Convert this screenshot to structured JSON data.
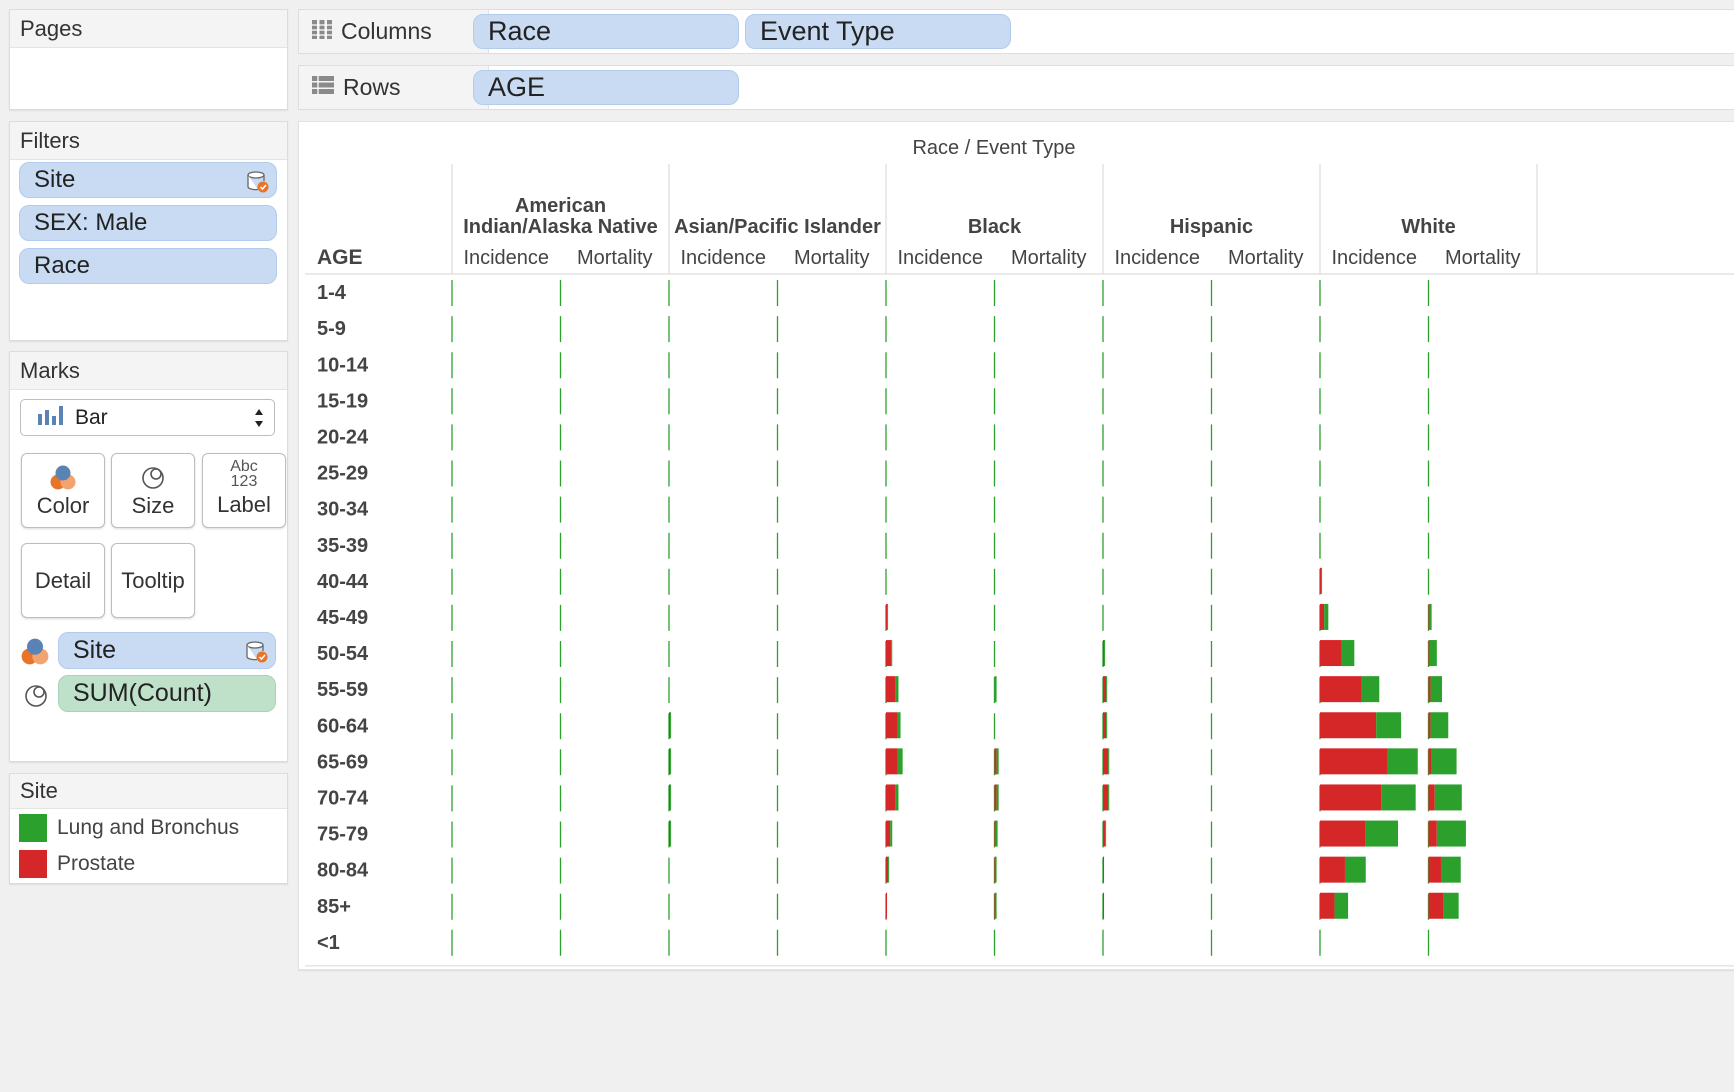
{
  "pages": {
    "title": "Pages"
  },
  "filters": {
    "title": "Filters",
    "items": [
      "Site",
      "SEX: Male",
      "Race"
    ]
  },
  "shelves": {
    "columns": {
      "label": "Columns",
      "pills": [
        "Race",
        "Event Type"
      ]
    },
    "rows": {
      "label": "Rows",
      "pills": [
        "AGE"
      ]
    }
  },
  "marks": {
    "title": "Marks",
    "mark_type": "Bar",
    "buttons": [
      "Color",
      "Size",
      "Label",
      "Detail",
      "Tooltip"
    ],
    "label_icon_text": [
      "Abc",
      "123"
    ],
    "fields": [
      {
        "icon": "color-icon",
        "label": "Site",
        "kind": "dimension"
      },
      {
        "icon": "size-icon",
        "label": "SUM(Count)",
        "kind": "measure"
      }
    ]
  },
  "legend": {
    "title": "Site",
    "items": [
      {
        "label": "Lung and Bronchus",
        "color": "#2ca02c"
      },
      {
        "label": "Prostate",
        "color": "#d62728"
      }
    ]
  },
  "chart_data": {
    "type": "bar",
    "orientation": "horizontal-stacked",
    "header_title": "Race  /  Event Type",
    "row_header": "AGE",
    "races": [
      "American Indian/Alaska Native",
      "Asian/Pacific Islander",
      "Black",
      "Hispanic",
      "White"
    ],
    "event_types": [
      "Incidence",
      "Mortality"
    ],
    "ages": [
      "1-4",
      "5-9",
      "10-14",
      "15-19",
      "20-24",
      "25-29",
      "30-34",
      "35-39",
      "40-44",
      "45-49",
      "50-54",
      "55-59",
      "60-64",
      "65-69",
      "70-74",
      "75-79",
      "80-84",
      "85+",
      "<1"
    ],
    "series_names": [
      "Prostate",
      "Lung and Bronchus"
    ],
    "colors": {
      "Prostate": "#d62728",
      "Lung and Bronchus": "#2ca02c"
    },
    "xlim_per_panel": [
      0,
      100
    ],
    "values": {
      "American Indian/Alaska Native": {
        "Incidence": {
          "Prostate": [
            0,
            0,
            0,
            0,
            0,
            0,
            0,
            0,
            0,
            0,
            0,
            0,
            0,
            0,
            0,
            0,
            0,
            0,
            0
          ],
          "Lung and Bronchus": [
            0,
            0,
            0,
            0,
            0,
            0,
            0,
            0,
            0,
            0,
            0,
            0,
            0,
            0,
            0,
            0,
            0,
            0,
            0
          ]
        },
        "Mortality": {
          "Prostate": [
            0,
            0,
            0,
            0,
            0,
            0,
            0,
            0,
            0,
            0,
            0,
            0,
            0,
            0,
            0,
            0,
            0,
            0,
            0
          ],
          "Lung and Bronchus": [
            0,
            0,
            0,
            0,
            0,
            0,
            0,
            0,
            0,
            0,
            0,
            0,
            0,
            0,
            0,
            0,
            0,
            0,
            0
          ]
        }
      },
      "Asian/Pacific Islander": {
        "Incidence": {
          "Prostate": [
            0,
            0,
            0,
            0,
            0,
            0,
            0,
            0,
            0,
            0,
            0,
            0,
            1,
            1,
            1,
            1,
            0,
            0,
            0
          ],
          "Lung and Bronchus": [
            0,
            0,
            0,
            0,
            0,
            0,
            0,
            0,
            0,
            0,
            0,
            0,
            1,
            1,
            1,
            1,
            0,
            0,
            0
          ]
        },
        "Mortality": {
          "Prostate": [
            0,
            0,
            0,
            0,
            0,
            0,
            0,
            0,
            0,
            0,
            0,
            0,
            0,
            0,
            0,
            0,
            0,
            0,
            0
          ],
          "Lung and Bronchus": [
            0,
            0,
            0,
            0,
            0,
            0,
            0,
            0,
            0,
            0,
            0,
            0,
            0,
            0,
            0,
            0,
            0,
            0,
            0
          ]
        }
      },
      "Black": {
        "Incidence": {
          "Prostate": [
            0,
            0,
            0,
            0,
            0,
            0,
            0,
            0,
            0,
            1,
            5,
            9,
            11,
            11,
            9,
            4,
            2,
            1,
            0
          ],
          "Lung and Bronchus": [
            0,
            0,
            0,
            0,
            0,
            0,
            0,
            0,
            0,
            1,
            1,
            3,
            3,
            5,
            3,
            2,
            1,
            0,
            0
          ]
        },
        "Mortality": {
          "Prostate": [
            0,
            0,
            0,
            0,
            0,
            0,
            0,
            0,
            0,
            0,
            0,
            0,
            0,
            2,
            2,
            1,
            1,
            1,
            0
          ],
          "Lung and Bronchus": [
            0,
            0,
            0,
            0,
            0,
            0,
            0,
            0,
            0,
            0,
            0,
            2,
            0,
            2,
            2,
            2,
            1,
            1,
            0
          ]
        }
      },
      "Hispanic": {
        "Incidence": {
          "Prostate": [
            0,
            0,
            0,
            0,
            0,
            0,
            0,
            0,
            0,
            0,
            1,
            3,
            3,
            5,
            5,
            2,
            1,
            1,
            0
          ],
          "Lung and Bronchus": [
            0,
            0,
            0,
            0,
            0,
            0,
            0,
            0,
            0,
            0,
            1,
            1,
            1,
            1,
            1,
            1,
            0,
            0,
            0
          ]
        },
        "Mortality": {
          "Prostate": [
            0,
            0,
            0,
            0,
            0,
            0,
            0,
            0,
            0,
            0,
            0,
            0,
            0,
            0,
            0,
            0,
            0,
            0,
            0
          ],
          "Lung and Bronchus": [
            0,
            0,
            0,
            0,
            0,
            0,
            0,
            0,
            0,
            0,
            0,
            0,
            0,
            0,
            0,
            0,
            0,
            0,
            0
          ]
        }
      },
      "White": {
        "Incidence": {
          "Prostate": [
            0,
            0,
            0,
            0,
            0,
            0,
            0,
            0,
            1,
            4,
            21,
            40,
            54,
            65,
            59,
            44,
            24,
            14,
            0
          ],
          "Lung and Bronchus": [
            0,
            0,
            0,
            0,
            0,
            0,
            0,
            0,
            1,
            4,
            12,
            17,
            24,
            29,
            33,
            31,
            20,
            13,
            0
          ]
        },
        "Mortality": {
          "Prostate": [
            0,
            0,
            0,
            0,
            0,
            0,
            0,
            0,
            0,
            1,
            1,
            2,
            2,
            3,
            6,
            8,
            12,
            14,
            0
          ],
          "Lung and Bronchus": [
            0,
            0,
            0,
            0,
            0,
            0,
            0,
            0,
            0,
            2,
            7,
            11,
            17,
            24,
            26,
            28,
            19,
            15,
            0
          ]
        }
      }
    }
  }
}
